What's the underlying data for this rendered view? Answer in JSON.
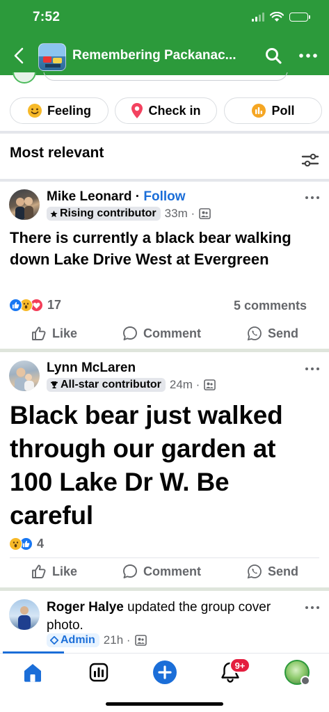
{
  "status_bar": {
    "time": "7:52"
  },
  "header": {
    "title": "Remembering Packanac..."
  },
  "chips": {
    "feeling": "Feeling",
    "check_in": "Check in",
    "poll": "Poll"
  },
  "sort": {
    "label": "Most relevant"
  },
  "posts": [
    {
      "author": "Mike Leonard",
      "separator": " · ",
      "follow": "Follow",
      "badge": "Rising contributor",
      "time": "33m ·",
      "text": "There is currently a black bear walking down Lake Drive West at Evergreen",
      "reactions_count": "17",
      "comments": "5 comments",
      "actions": {
        "like": "Like",
        "comment": "Comment",
        "send": "Send"
      }
    },
    {
      "author": "Lynn McLaren",
      "badge": "All-star contributor",
      "time": "24m ·",
      "text": "Black bear just walked through our garden at 100 Lake Dr W. Be careful",
      "reactions_count": "4",
      "actions": {
        "like": "Like",
        "comment": "Comment",
        "send": "Send"
      }
    },
    {
      "author": "Roger Halye",
      "activity": "updated the group cover photo.",
      "badge": "Admin",
      "time": "21h ·"
    }
  ],
  "bottom_nav": {
    "items": [
      "home-icon",
      "feeds-icon",
      "create-icon",
      "notifications-icon",
      "profile-icon"
    ],
    "notification_badge": "9+"
  },
  "colors": {
    "brand_green": "#2c9a3b",
    "link_blue": "#1b6ed8",
    "notification_red": "#e41e3f"
  }
}
